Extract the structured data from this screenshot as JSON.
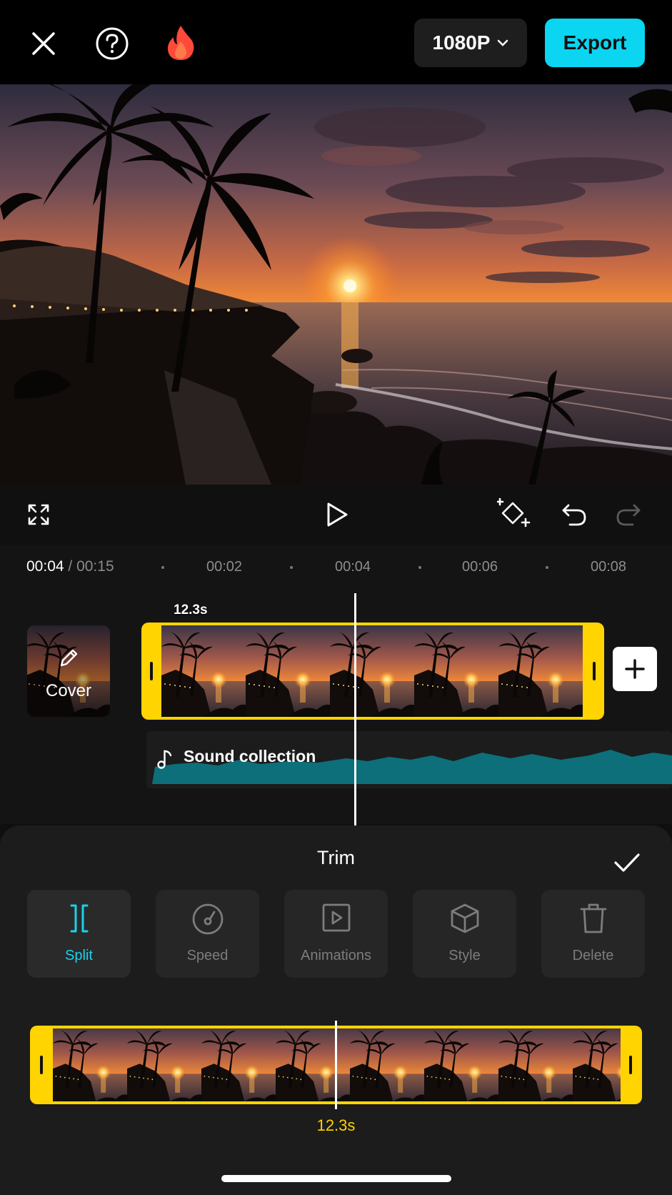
{
  "topbar": {
    "resolution_label": "1080P",
    "export_label": "Export",
    "icons": [
      "close-icon",
      "help-icon",
      "fire-icon",
      "chevron-down-icon"
    ]
  },
  "player": {
    "icons": [
      "fullscreen-icon",
      "play-icon",
      "keyframe-icon",
      "undo-icon",
      "redo-icon"
    ]
  },
  "ruler": {
    "current_time": "00:04",
    "total_time": "/ 00:15",
    "ticks": [
      "00:02",
      "00:04",
      "00:06",
      "00:08"
    ]
  },
  "timeline": {
    "cover_label": "Cover",
    "clip_duration": "12.3s",
    "audio_label": "Sound collection"
  },
  "panel": {
    "title": "Trim",
    "tools": [
      {
        "label": "Split",
        "icon": "split-icon",
        "active": true
      },
      {
        "label": "Speed",
        "icon": "speed-icon",
        "active": false
      },
      {
        "label": "Animations",
        "icon": "animations-icon",
        "active": false
      },
      {
        "label": "Style",
        "icon": "style-icon",
        "active": false
      },
      {
        "label": "Delete",
        "icon": "delete-icon",
        "active": false
      }
    ],
    "trim_duration": "12.3s"
  },
  "colors": {
    "accent_cyan": "#0bd5f0",
    "clip_yellow": "#ffd400",
    "audio_teal": "#0c6f7a"
  }
}
